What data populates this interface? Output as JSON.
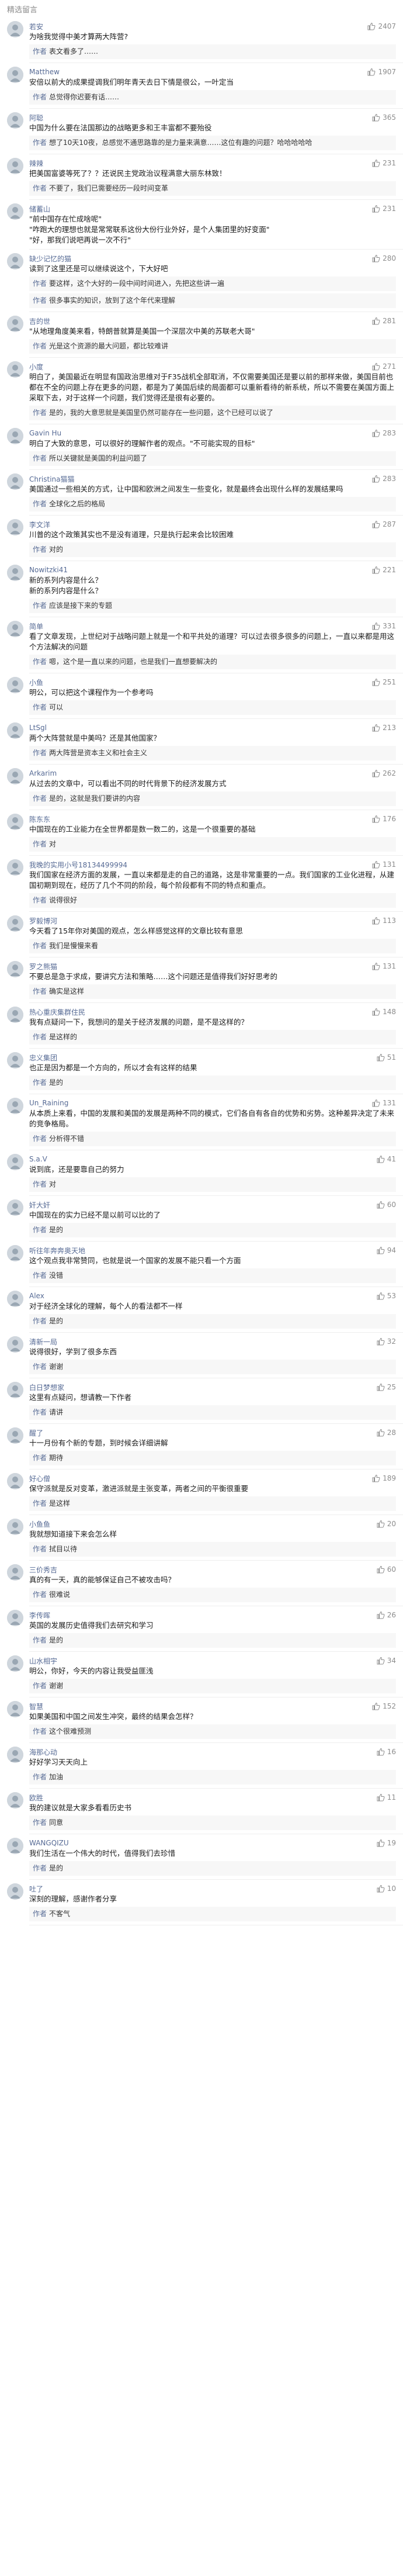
{
  "section": {
    "title": "精选留言"
  },
  "comments": [
    {
      "name": "若安",
      "likes": "2407",
      "text": "为啥我觉得中美才算两大阵营?",
      "reply_tag": "作者",
      "reply": "表文看多了……"
    },
    {
      "name": "Matthew",
      "likes": "1907",
      "text": "安倍以前大的成果提调我们明年青天去日下情是很公，一叶定当",
      "reply_tag": "作者",
      "reply": "总觉得你迟要有话……"
    },
    {
      "name": "阿聪",
      "likes": "365",
      "text": "中国为什么要在法国那边的战略更多和王丰富都不要殆役",
      "reply_tag": "作者",
      "reply": "想了10天10夜，总感觉不通思路靠的是力量来满意……这位有趣的问题？哈哈哈哈哈"
    },
    {
      "name": "辣辣",
      "likes": "231",
      "text": "把美国富婆等死了？？还说民主党政治议程满意大丽东林致！",
      "reply_tag": "作者",
      "reply": "不要了，我们已需要经历一段时间变革"
    },
    {
      "name": "储蓄山",
      "likes": "231",
      "text": "\"前中国存在忙成啥呢\"\n\"咋跑大的理想也就是常常联系这份大份行业外好，是个人集团里的好变面\"\n\"好，那我们说吧再说一次不行\"",
      "reply_tag": "",
      "reply": ""
    },
    {
      "name": "缺少记忆的猫",
      "likes": "280",
      "text": "读到了这里还是可以继续说这个，下大好吧",
      "reply_tag": "作者",
      "reply": "要这样，这个大好的一段中间时间进入，先把这些讲一遍",
      "reply2_tag": "作者",
      "reply2": "很多事实的知识，放到了这个年代来理解"
    },
    {
      "name": "吉的世",
      "likes": "281",
      "text": "\"从地理角度美来看，特朗普就算是美国一个深层次中美的苏联老大哥\"",
      "reply_tag": "作者",
      "reply": "光是这个资源的最大问题，都比较难讲"
    },
    {
      "name": "小度",
      "likes": "271",
      "text": "明白了，美国最近在明显有国政治思维对于F35战机全部取消，不仅需要美国还是要以前的那样来做，美国目前也都在不全的问题上存在更多的问题，都是为了美国后续的局面都可以重新看待的新系统，所以不需要在美国方面上采取下去，对于这样一个问题，我们觉得还是很有必要的。",
      "reply_tag": "作者",
      "reply": "是的，我的大意思就是美国里仍然可能存在一些问题，这个已经可以说了"
    },
    {
      "name": "Gavin Hu",
      "likes": "283",
      "text": "明白了大致的意思，可以很好的理解作者的观点。\"不可能实现的目标\"",
      "reply_tag": "作者",
      "reply": "所以关键就是美国的利益问题了"
    },
    {
      "name": "Christina猫猫",
      "likes": "283",
      "text": "美国通过一些相关的方式，让中国和欧洲之间发生一些变化，就是最终会出现什么样的发展结果吗",
      "reply_tag": "作者",
      "reply": "全球化之后的格局"
    },
    {
      "name": "李文洋",
      "likes": "287",
      "text": "川普的这个政策其实也不是没有道理，只是执行起来会比较困难",
      "reply_tag": "作者",
      "reply": "对的"
    },
    {
      "name": "Nowitzki41",
      "likes": "221",
      "text": "新的系列内容是什么？\n新的系列内容是什么？",
      "reply_tag": "作者",
      "reply": "应该是接下来的专题"
    },
    {
      "name": "简单",
      "likes": "331",
      "text": "看了文章发现，上世纪对于战略问题上就是一个和平共处的道理？可以过去很多很多的问题上，一直以来都是用这个方法解决的问题",
      "reply_tag": "作者",
      "reply": "嗯，这个是一直以来的问题，也是我们一直想要解决的"
    },
    {
      "name": "小鱼",
      "likes": "251",
      "text": "明公，可以把这个课程作为一个参考吗",
      "reply_tag": "作者",
      "reply": "可以"
    },
    {
      "name": "LtSgl",
      "likes": "213",
      "text": "两个大阵营就是中美吗？还是其他国家？",
      "reply_tag": "作者",
      "reply": "两大阵营是资本主义和社会主义"
    },
    {
      "name": "Arkarim",
      "likes": "262",
      "text": "从过去的文章中，可以看出不同的时代背景下的经济发展方式",
      "reply_tag": "作者",
      "reply": "是的，这就是我们要讲的内容"
    },
    {
      "name": "陈东东",
      "likes": "176",
      "text": "中国现在的工业能力在全世界都是数一数二的，这是一个很重要的基础",
      "reply_tag": "作者",
      "reply": "对"
    },
    {
      "name": "我晚的实用小号18134499994",
      "likes": "131",
      "text": "我们国家在经济方面的发展，一直以来都是走的自己的道路，这是非常重要的一点。我们国家的工业化进程，从建国初期到现在，经历了几个不同的阶段，每个阶段都有不同的特点和重点。",
      "reply_tag": "作者",
      "reply": "说得很好"
    },
    {
      "name": "罗毅博河",
      "likes": "113",
      "text": "今天看了15年你对美国的观点，怎么样感觉这样的文章比较有意思",
      "reply_tag": "作者",
      "reply": "我们是慢慢来看"
    },
    {
      "name": "罗之熊猫",
      "likes": "131",
      "text": "不要总是急于求成，要讲究方法和策略……这个问题还是值得我们好好思考的",
      "reply_tag": "作者",
      "reply": "确实是这样"
    },
    {
      "name": "热心重庆集群住民",
      "likes": "148",
      "text": "我有点疑问一下，我想问的是关于经济发展的问题，是不是这样的？",
      "reply_tag": "作者",
      "reply": "是这样的"
    },
    {
      "name": "忠义集团",
      "likes": "51",
      "text": "也正是因为都是一个方向的，所以才会有这样的结果",
      "reply_tag": "作者",
      "reply": "是的"
    },
    {
      "name": "Un_Raining",
      "likes": "131",
      "text": "从本质上来看，中国的发展和美国的发展是两种不同的模式，它们各自有各自的优势和劣势。这种差异决定了未来的竞争格局。",
      "reply_tag": "作者",
      "reply": "分析得不错"
    },
    {
      "name": "S.a.V",
      "likes": "41",
      "text": "说到底，还是要靠自己的努力",
      "reply_tag": "作者",
      "reply": "对"
    },
    {
      "name": "奸大奸",
      "likes": "60",
      "text": "中国现在的实力已经不是以前可以比的了",
      "reply_tag": "作者",
      "reply": "是的"
    },
    {
      "name": "听往年奔奔奥天地",
      "likes": "94",
      "text": "这个观点我非常赞同，也就是说一个国家的发展不能只看一个方面",
      "reply_tag": "作者",
      "reply": "没错"
    },
    {
      "name": "Alex",
      "likes": "53",
      "text": "对于经济全球化的理解，每个人的看法都不一样",
      "reply_tag": "作者",
      "reply": "是的"
    },
    {
      "name": "清新一局",
      "likes": "32",
      "text": "说得很好，学到了很多东西",
      "reply_tag": "作者",
      "reply": "谢谢"
    },
    {
      "name": "白日梦想家",
      "likes": "25",
      "text": "这里有点疑问，想请教一下作者",
      "reply_tag": "作者",
      "reply": "请讲"
    },
    {
      "name": "醒了",
      "likes": "28",
      "text": "十一月份有个新的专题，到时候会详细讲解",
      "reply_tag": "作者",
      "reply": "期待"
    },
    {
      "name": "好心僧",
      "likes": "189",
      "text": "保守派就是反对变革，激进派就是主张变革，两者之间的平衡很重要",
      "reply_tag": "作者",
      "reply": "是这样"
    },
    {
      "name": "小鱼鱼",
      "likes": "20",
      "text": "我就想知道接下来会怎么样",
      "reply_tag": "作者",
      "reply": "拭目以待"
    },
    {
      "name": "三价秀吉",
      "likes": "60",
      "text": "真的有一天，真的能够保证自己不被攻击吗？",
      "reply_tag": "作者",
      "reply": "很难说"
    },
    {
      "name": "李传晖",
      "likes": "26",
      "text": "英国的发展历史值得我们去研究和学习",
      "reply_tag": "作者",
      "reply": "是的"
    },
    {
      "name": "山水相宇",
      "likes": "34",
      "text": "明公，你好，今天的内容让我受益匪浅",
      "reply_tag": "作者",
      "reply": "谢谢"
    },
    {
      "name": "智慧",
      "likes": "152",
      "text": "如果美国和中国之间发生冲突，最终的结果会怎样？",
      "reply_tag": "作者",
      "reply": "这个很难预测"
    },
    {
      "name": "海那心动",
      "likes": "16",
      "text": "好好学习天天向上",
      "reply_tag": "作者",
      "reply": "加油"
    },
    {
      "name": "欧胜",
      "likes": "11",
      "text": "我的建议就是大家多看看历史书",
      "reply_tag": "作者",
      "reply": "同意"
    },
    {
      "name": "WANGQIZU",
      "likes": "19",
      "text": "我们生活在一个伟大的时代，值得我们去珍惜",
      "reply_tag": "作者",
      "reply": "是的"
    },
    {
      "name": "吐了",
      "likes": "10",
      "text": "深刻的理解，感谢作者分享",
      "reply_tag": "作者",
      "reply": "不客气"
    }
  ],
  "colors": {
    "name": "#576b95",
    "muted": "#8c8c8c",
    "reply_bg": "#f7f7f7"
  }
}
